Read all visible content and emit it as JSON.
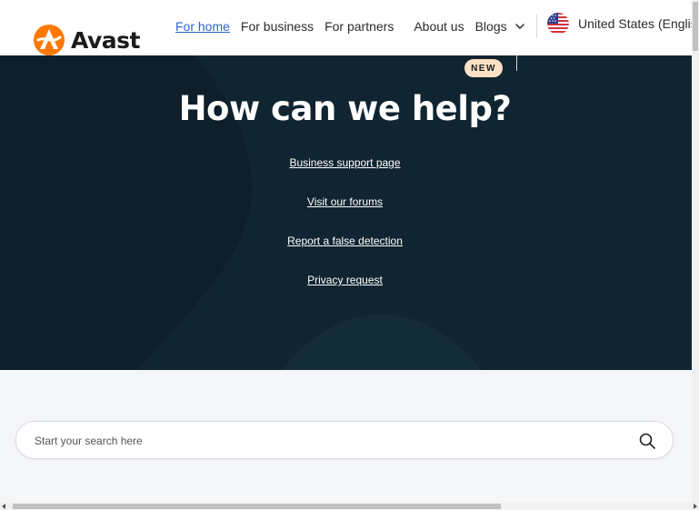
{
  "brand": {
    "name": "Avast",
    "logo_icon": "avast-logo-icon",
    "accent_color": "#ff7800"
  },
  "nav": {
    "items": [
      {
        "label": "For home",
        "active": true
      },
      {
        "label": "For business"
      },
      {
        "label": "For partners"
      },
      {
        "label": "About us"
      },
      {
        "label": "Blogs",
        "has_dropdown": true
      }
    ]
  },
  "region": {
    "label": "United States (Englis",
    "flag_icon": "us-flag-icon"
  },
  "hero": {
    "badge": "NEW",
    "title": "How can we help?",
    "links": [
      "Business support page",
      "Visit our forums",
      "Report a false detection",
      "Privacy request"
    ],
    "background_color": "#0e1f2b"
  },
  "search": {
    "placeholder": "Start your search here",
    "icon": "search-icon"
  }
}
